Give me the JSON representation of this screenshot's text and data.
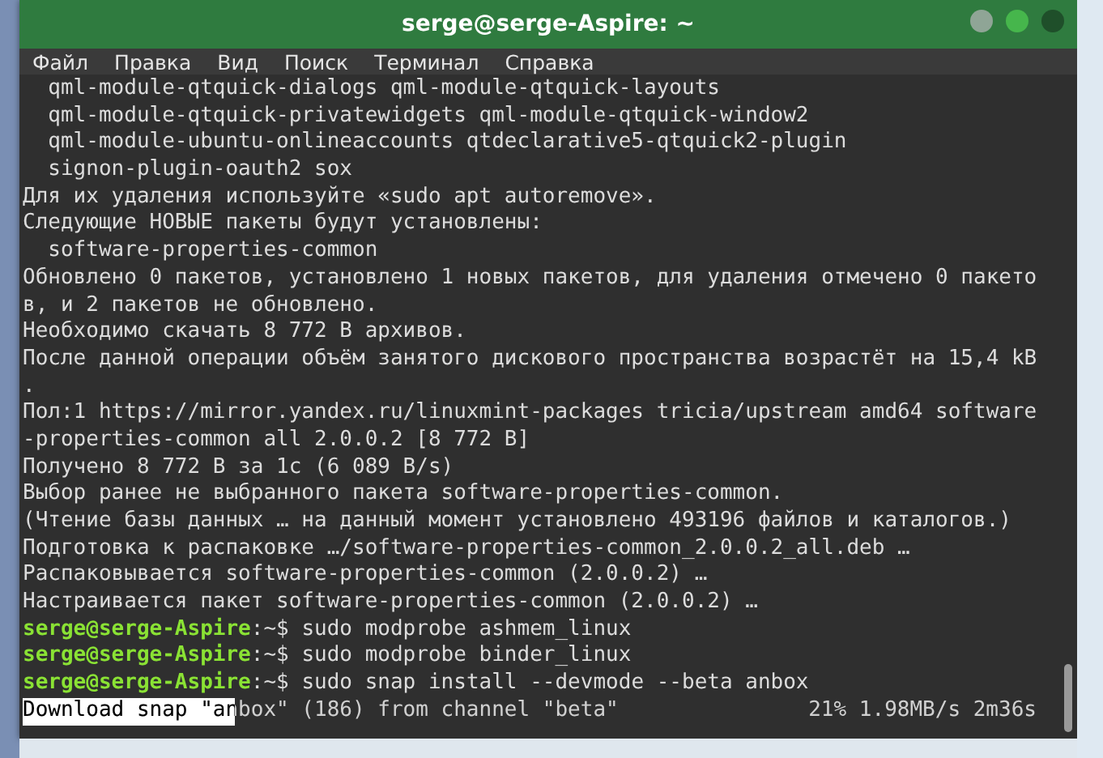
{
  "window": {
    "title": "serge@serge-Aspire: ~"
  },
  "menu": [
    "Файл",
    "Правка",
    "Вид",
    "Поиск",
    "Терминал",
    "Справка"
  ],
  "lines": [
    {
      "kind": "text",
      "text": "  qml-module-qtquick-dialogs qml-module-qtquick-layouts"
    },
    {
      "kind": "text",
      "text": "  qml-module-qtquick-privatewidgets qml-module-qtquick-window2"
    },
    {
      "kind": "text",
      "text": "  qml-module-ubuntu-onlineaccounts qtdeclarative5-qtquick2-plugin"
    },
    {
      "kind": "text",
      "text": "  signon-plugin-oauth2 sox"
    },
    {
      "kind": "text",
      "text": "Для их удаления используйте «sudo apt autoremove»."
    },
    {
      "kind": "text",
      "text": "Следующие НОВЫЕ пакеты будут установлены:"
    },
    {
      "kind": "text",
      "text": "  software-properties-common"
    },
    {
      "kind": "text",
      "text": "Обновлено 0 пакетов, установлено 1 новых пакетов, для удаления отмечено 0 пакето"
    },
    {
      "kind": "text",
      "text": "в, и 2 пакетов не обновлено."
    },
    {
      "kind": "text",
      "text": "Необходимо скачать 8 772 B архивов."
    },
    {
      "kind": "text",
      "text": "После данной операции объём занятого дискового пространства возрастёт на 15,4 kB"
    },
    {
      "kind": "text",
      "text": "."
    },
    {
      "kind": "text",
      "text": "Пол:1 https://mirror.yandex.ru/linuxmint-packages tricia/upstream amd64 software"
    },
    {
      "kind": "text",
      "text": "-properties-common all 2.0.0.2 [8 772 B]"
    },
    {
      "kind": "text",
      "text": "Получено 8 772 B за 1с (6 089 B/s)"
    },
    {
      "kind": "text",
      "text": "Выбор ранее не выбранного пакета software-properties-common."
    },
    {
      "kind": "text",
      "text": "(Чтение базы данных … на данный момент установлено 493196 файлов и каталогов.)"
    },
    {
      "kind": "text",
      "text": "Подготовка к распаковке …/software-properties-common_2.0.0.2_all.deb …"
    },
    {
      "kind": "text",
      "text": "Распаковывается software-properties-common (2.0.0.2) …"
    },
    {
      "kind": "text",
      "text": "Настраивается пакет software-properties-common (2.0.0.2) …"
    },
    {
      "kind": "prompt",
      "user": "serge@serge-Aspire",
      "text": ":~$ sudo modprobe ashmem_linux"
    },
    {
      "kind": "prompt",
      "user": "serge@serge-Aspire",
      "text": ":~$ sudo modprobe binder_linux"
    },
    {
      "kind": "prompt",
      "user": "serge@serge-Aspire",
      "text": ":~$ sudo snap install --devmode --beta anbox"
    },
    {
      "kind": "progress",
      "text": "Download snap \"anbox\" (186) from channel \"beta\"",
      "stats": "21% 1.98MB/s 2m36s",
      "level": 0.21
    }
  ]
}
